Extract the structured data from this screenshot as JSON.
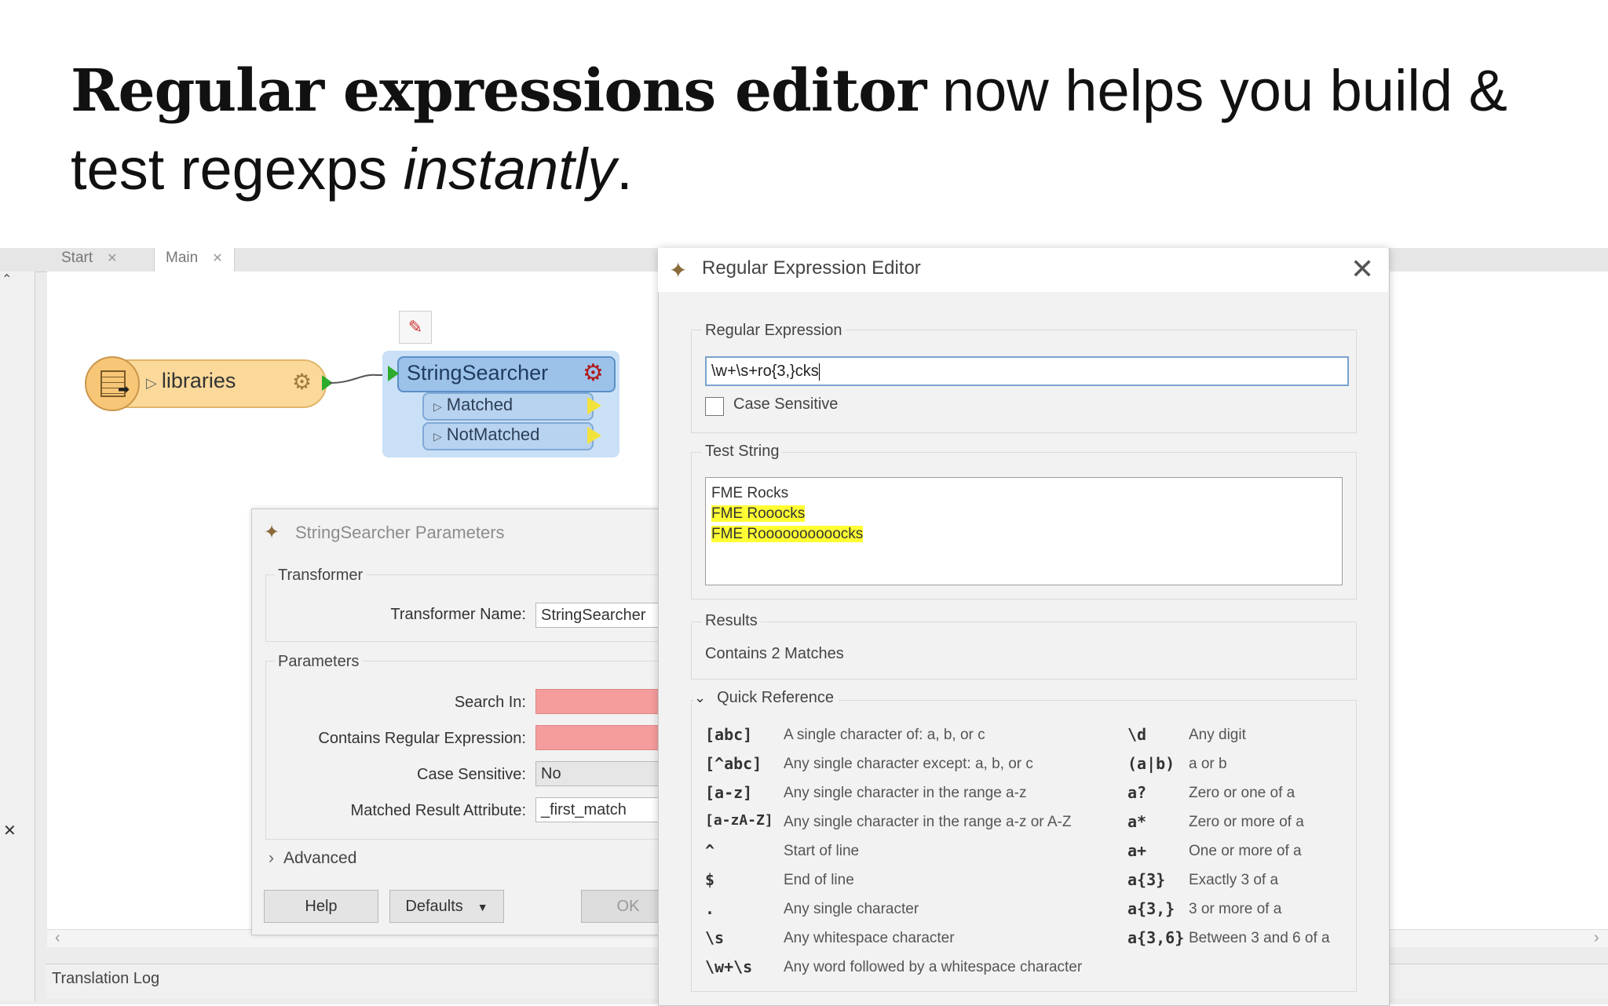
{
  "headline": {
    "bold": "Regular expressions editor",
    "rest": " now helps you build & test regexps ",
    "italic": "instantly",
    "end": "."
  },
  "workbench": {
    "tabs": [
      {
        "label": "Start"
      },
      {
        "label": "Main"
      }
    ],
    "tab_close_glyph": "✕",
    "translation_log_label": "Translation Log",
    "rail_close_glyph": "✕",
    "rail_top_glyph": "⌃",
    "scroll_left_glyph": "‹",
    "scroll_right_glyph": "›"
  },
  "canvas": {
    "reader": {
      "label": "libraries",
      "icon": "table-icon",
      "gear_icon": "gear-icon"
    },
    "inspect_icon": "pin-icon",
    "transformer": {
      "title": "StringSearcher",
      "ports": [
        {
          "label": "Matched"
        },
        {
          "label": "NotMatched"
        }
      ],
      "gear_icon": "gear-icon",
      "connector_color": "#2cab2c",
      "header_color": "#9cc2ea"
    }
  },
  "params_dialog": {
    "title": "StringSearcher Parameters",
    "transformer_group": "Transformer",
    "transformer_name_label": "Transformer Name:",
    "transformer_name_value": "StringSearcher",
    "parameters_group": "Parameters",
    "search_in_label": "Search In:",
    "contains_regex_label": "Contains Regular Expression:",
    "case_sensitive_label": "Case Sensitive:",
    "case_sensitive_value": "No",
    "matched_attr_label": "Matched Result Attribute:",
    "matched_attr_value": "_first_match",
    "advanced_label": "Advanced",
    "help_button": "Help",
    "defaults_button": "Defaults",
    "ok_button": "OK",
    "required_color": "#f59c9c"
  },
  "regex_editor": {
    "title": "Regular Expression Editor",
    "close_glyph": "✕",
    "regex_label": "Regular Expression",
    "regex_value": "\\w+\\s+ro{3,}cks",
    "case_sensitive_label": "Case Sensitive",
    "test_string_label": "Test String",
    "test_lines": [
      {
        "text": "FME Rocks",
        "highlight": false
      },
      {
        "text": "FME Rooocks",
        "highlight": true
      },
      {
        "text": "FME Roooooooooocks",
        "highlight": true
      }
    ],
    "results_label": "Results",
    "results_text": "Contains 2 Matches",
    "quick_reference_label": "Quick Reference",
    "highlight_color": "#ffff33",
    "quick_reference_left": [
      {
        "token": "[abc]",
        "desc": "A single character of: a, b, or c"
      },
      {
        "token": "[^abc]",
        "desc": "Any single character except: a, b, or c"
      },
      {
        "token": "[a-z]",
        "desc": "Any single character in the range a-z"
      },
      {
        "token": "[a-zA-Z]",
        "desc": "Any single character in the range a-z or A-Z"
      },
      {
        "token": "^",
        "desc": "Start of line"
      },
      {
        "token": "$",
        "desc": "End of line"
      },
      {
        "token": ".",
        "desc": "Any single character"
      },
      {
        "token": "\\s",
        "desc": "Any whitespace character"
      },
      {
        "token": "\\w+\\s",
        "desc": "Any word followed by a whitespace character"
      }
    ],
    "quick_reference_right": [
      {
        "token": "\\d",
        "desc": "Any digit"
      },
      {
        "token": "(a|b)",
        "desc": "a or b"
      },
      {
        "token": "a?",
        "desc": "Zero or one of a"
      },
      {
        "token": "a*",
        "desc": "Zero or more of a"
      },
      {
        "token": "a+",
        "desc": "One or more of a"
      },
      {
        "token": "a{3}",
        "desc": "Exactly 3 of a"
      },
      {
        "token": "a{3,}",
        "desc": "3 or more of a"
      },
      {
        "token": "a{3,6}",
        "desc": "Between 3 and 6 of a"
      }
    ]
  }
}
